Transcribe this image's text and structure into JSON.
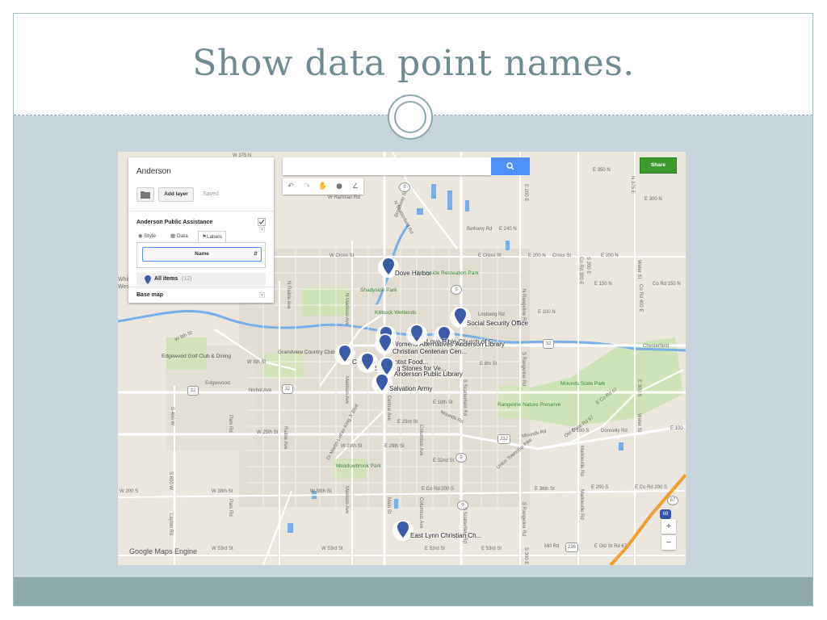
{
  "slide": {
    "title": "Show data point names."
  },
  "colors": {
    "title": "#6f8b91",
    "accent_blue": "#4d90fe",
    "share_green": "#3d9a2f",
    "pin_blue": "#3b5ba8",
    "highway_orange": "#f0a030"
  },
  "map_app": {
    "panel": {
      "map_title": "Anderson",
      "folder_icon": "folder-icon",
      "add_layer_label": "Add layer",
      "saved_status": "Saved",
      "layer_name": "Anderson Public Assistance",
      "tabs": [
        {
          "label": "Style",
          "icon": "paint-icon"
        },
        {
          "label": "Data",
          "icon": "grid-icon"
        },
        {
          "label": "Labels",
          "icon": "label-icon",
          "active": true
        }
      ],
      "label_field_selected": "Name",
      "all_items_label": "All items",
      "all_items_count": "(12)",
      "base_map_label": "Base map"
    },
    "search": {
      "value": "",
      "button_icon": "search-icon"
    },
    "toolbar_icons": [
      "undo-icon",
      "redo-icon",
      "hand-icon",
      "marker-icon",
      "line-icon"
    ],
    "share_label": "Share",
    "zoom": {
      "in": "+",
      "out": "−"
    },
    "attribution": "Google Maps Engine",
    "pins": [
      {
        "name": "Dove Harbor"
      },
      {
        "name": "Social Security Office"
      },
      {
        "name": "Love Bible Church of G..."
      },
      {
        "name": "Womens Alternatives Inc."
      },
      {
        "name": "Anderson Library"
      },
      {
        "name": "Christian Centenan Cen..."
      },
      {
        "name": "Community Baptist Food..."
      },
      {
        "name": "Standing Stones for Ve..."
      },
      {
        "name": "Anderson Public Library"
      },
      {
        "name": "Salvation Army"
      },
      {
        "name": "East Lynn Christian Ch..."
      }
    ],
    "place_labels": {
      "shadyside_recreation": "Shadyside Recreation Park",
      "shadyside_park": "Shadyside Park",
      "killbuck": "Killbuck Wetlands",
      "grandview": "Grandview Country Club",
      "edgewood_golf": "Edgewood Golf Club & Dining",
      "edgewood": "Edgewood",
      "mounds": "Mounds State Park",
      "rangeline": "Rangeline Nature Preserve",
      "meadowbrook": "Meadowbrook Park",
      "chesterfield": "Chesterfield",
      "white": "Whit",
      "west": "West"
    },
    "street_labels": {
      "w8th": "W 8th St",
      "w8th2": "W 8th St",
      "nichol": "Nichol Ave",
      "w25th": "W 25th St",
      "w29th": "W 29th St",
      "e29th": "E 29th St",
      "w38th": "W 38th St",
      "w38th2": "W 38th St",
      "e38th": "E 38th St",
      "w53rd": "W 53rd St",
      "w53rd2": "W 53rd St",
      "e53rd": "E 53rd St",
      "e53rd2": "E 53rd St",
      "mill": "Mill Rd",
      "oldst67": "E Old St Rd 67",
      "w200s": "W 200 S",
      "e200s": "E 200 S",
      "eco200": "E Co Rd 200 S",
      "eco200b": "E Co Rd 200 S",
      "e32nd": "E 32nd St",
      "e23rd": "E 23rd St",
      "e18th": "E 18th St",
      "e8th": "E 8th St",
      "wcross": "W Cross St",
      "ecross": "E Cross St",
      "e200n": "E 200 N",
      "e200n2": "E 200 N",
      "cross2": "Cross St",
      "e150n": "E 150 N",
      "corrd150n": "Co Rd 150 N",
      "e100n": "E 100 N",
      "lindberg": "Lindberg Rd",
      "bethany": "Bethany Rd",
      "e240n": "E 240 N",
      "whartman": "W Hartman Rd",
      "e350n": "E 350 N",
      "e300n": "E 300 N",
      "e100s": "E 100 S",
      "donnelly": "Donnelly Rd",
      "e100": "E 100",
      "moundsrd": "Mounds Rd",
      "corrd67": "E Co Rd 67",
      "oldstate67": "Old State Rd 67",
      "uniontwp": "Union Township Pike",
      "broadway": "Broadway St",
      "nscatter": "N Scatterfield Rd",
      "nmadison": "N Madison Ave",
      "nraible": "N Raible Ave",
      "raible": "Raible Ave",
      "parkrd": "Park Rd",
      "parkrd2": "Park Rd",
      "s400w": "S 400 W",
      "s600w": "S 600 W",
      "layton": "Layton Rd",
      "madison": "Madison Ave",
      "madison2": "Madison Ave",
      "central": "Central Ave",
      "main": "Main St",
      "columbus": "Columbus Ave",
      "columbus2": "Columbus Ave",
      "sscatter": "S Scatterfield Rd",
      "srangeline": "S Rangeline Rd",
      "srangeline2": "S Rangeline Rd",
      "nrangeline": "N Rangeline Rd",
      "markleville": "Markleville Rd",
      "markleville2": "Markleville Rd",
      "water": "Water St",
      "water2": "Water St",
      "mlk": "Dr Martin Luther King Jr Blvd",
      "e300s": "E 300 S",
      "e300": "E 300 E",
      "corrd300e": "Co Rd 300 E",
      "corrd400e": "Co Rd 400 E",
      "e200e": "E 200 E",
      "s300e": "S 300 E",
      "s200e": "S 200 E",
      "n375e": "N 375 E",
      "w375n": "W 375 N"
    },
    "route_shields": [
      "9",
      "9",
      "9",
      "9",
      "32",
      "32",
      "32",
      "232",
      "236",
      "67",
      "69"
    ]
  }
}
